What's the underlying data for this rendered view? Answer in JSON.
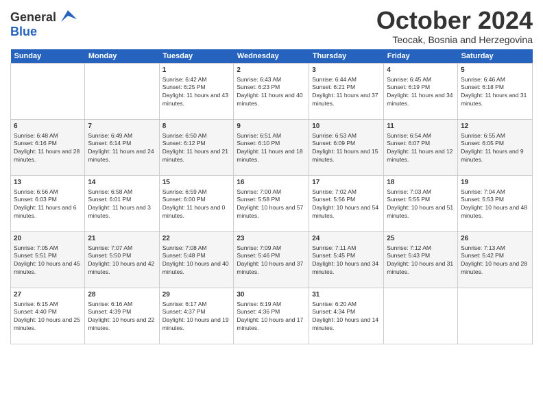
{
  "header": {
    "logo_line1": "General",
    "logo_line2": "Blue",
    "month": "October 2024",
    "location": "Teocak, Bosnia and Herzegovina"
  },
  "days_of_week": [
    "Sunday",
    "Monday",
    "Tuesday",
    "Wednesday",
    "Thursday",
    "Friday",
    "Saturday"
  ],
  "weeks": [
    [
      {
        "day": "",
        "info": ""
      },
      {
        "day": "",
        "info": ""
      },
      {
        "day": "1",
        "info": "Sunrise: 6:42 AM\nSunset: 6:25 PM\nDaylight: 11 hours and 43 minutes."
      },
      {
        "day": "2",
        "info": "Sunrise: 6:43 AM\nSunset: 6:23 PM\nDaylight: 11 hours and 40 minutes."
      },
      {
        "day": "3",
        "info": "Sunrise: 6:44 AM\nSunset: 6:21 PM\nDaylight: 11 hours and 37 minutes."
      },
      {
        "day": "4",
        "info": "Sunrise: 6:45 AM\nSunset: 6:19 PM\nDaylight: 11 hours and 34 minutes."
      },
      {
        "day": "5",
        "info": "Sunrise: 6:46 AM\nSunset: 6:18 PM\nDaylight: 11 hours and 31 minutes."
      }
    ],
    [
      {
        "day": "6",
        "info": "Sunrise: 6:48 AM\nSunset: 6:16 PM\nDaylight: 11 hours and 28 minutes."
      },
      {
        "day": "7",
        "info": "Sunrise: 6:49 AM\nSunset: 6:14 PM\nDaylight: 11 hours and 24 minutes."
      },
      {
        "day": "8",
        "info": "Sunrise: 6:50 AM\nSunset: 6:12 PM\nDaylight: 11 hours and 21 minutes."
      },
      {
        "day": "9",
        "info": "Sunrise: 6:51 AM\nSunset: 6:10 PM\nDaylight: 11 hours and 18 minutes."
      },
      {
        "day": "10",
        "info": "Sunrise: 6:53 AM\nSunset: 6:09 PM\nDaylight: 11 hours and 15 minutes."
      },
      {
        "day": "11",
        "info": "Sunrise: 6:54 AM\nSunset: 6:07 PM\nDaylight: 11 hours and 12 minutes."
      },
      {
        "day": "12",
        "info": "Sunrise: 6:55 AM\nSunset: 6:05 PM\nDaylight: 11 hours and 9 minutes."
      }
    ],
    [
      {
        "day": "13",
        "info": "Sunrise: 6:56 AM\nSunset: 6:03 PM\nDaylight: 11 hours and 6 minutes."
      },
      {
        "day": "14",
        "info": "Sunrise: 6:58 AM\nSunset: 6:01 PM\nDaylight: 11 hours and 3 minutes."
      },
      {
        "day": "15",
        "info": "Sunrise: 6:59 AM\nSunset: 6:00 PM\nDaylight: 11 hours and 0 minutes."
      },
      {
        "day": "16",
        "info": "Sunrise: 7:00 AM\nSunset: 5:58 PM\nDaylight: 10 hours and 57 minutes."
      },
      {
        "day": "17",
        "info": "Sunrise: 7:02 AM\nSunset: 5:56 PM\nDaylight: 10 hours and 54 minutes."
      },
      {
        "day": "18",
        "info": "Sunrise: 7:03 AM\nSunset: 5:55 PM\nDaylight: 10 hours and 51 minutes."
      },
      {
        "day": "19",
        "info": "Sunrise: 7:04 AM\nSunset: 5:53 PM\nDaylight: 10 hours and 48 minutes."
      }
    ],
    [
      {
        "day": "20",
        "info": "Sunrise: 7:05 AM\nSunset: 5:51 PM\nDaylight: 10 hours and 45 minutes."
      },
      {
        "day": "21",
        "info": "Sunrise: 7:07 AM\nSunset: 5:50 PM\nDaylight: 10 hours and 42 minutes."
      },
      {
        "day": "22",
        "info": "Sunrise: 7:08 AM\nSunset: 5:48 PM\nDaylight: 10 hours and 40 minutes."
      },
      {
        "day": "23",
        "info": "Sunrise: 7:09 AM\nSunset: 5:46 PM\nDaylight: 10 hours and 37 minutes."
      },
      {
        "day": "24",
        "info": "Sunrise: 7:11 AM\nSunset: 5:45 PM\nDaylight: 10 hours and 34 minutes."
      },
      {
        "day": "25",
        "info": "Sunrise: 7:12 AM\nSunset: 5:43 PM\nDaylight: 10 hours and 31 minutes."
      },
      {
        "day": "26",
        "info": "Sunrise: 7:13 AM\nSunset: 5:42 PM\nDaylight: 10 hours and 28 minutes."
      }
    ],
    [
      {
        "day": "27",
        "info": "Sunrise: 6:15 AM\nSunset: 4:40 PM\nDaylight: 10 hours and 25 minutes."
      },
      {
        "day": "28",
        "info": "Sunrise: 6:16 AM\nSunset: 4:39 PM\nDaylight: 10 hours and 22 minutes."
      },
      {
        "day": "29",
        "info": "Sunrise: 6:17 AM\nSunset: 4:37 PM\nDaylight: 10 hours and 19 minutes."
      },
      {
        "day": "30",
        "info": "Sunrise: 6:19 AM\nSunset: 4:36 PM\nDaylight: 10 hours and 17 minutes."
      },
      {
        "day": "31",
        "info": "Sunrise: 6:20 AM\nSunset: 4:34 PM\nDaylight: 10 hours and 14 minutes."
      },
      {
        "day": "",
        "info": ""
      },
      {
        "day": "",
        "info": ""
      }
    ]
  ]
}
